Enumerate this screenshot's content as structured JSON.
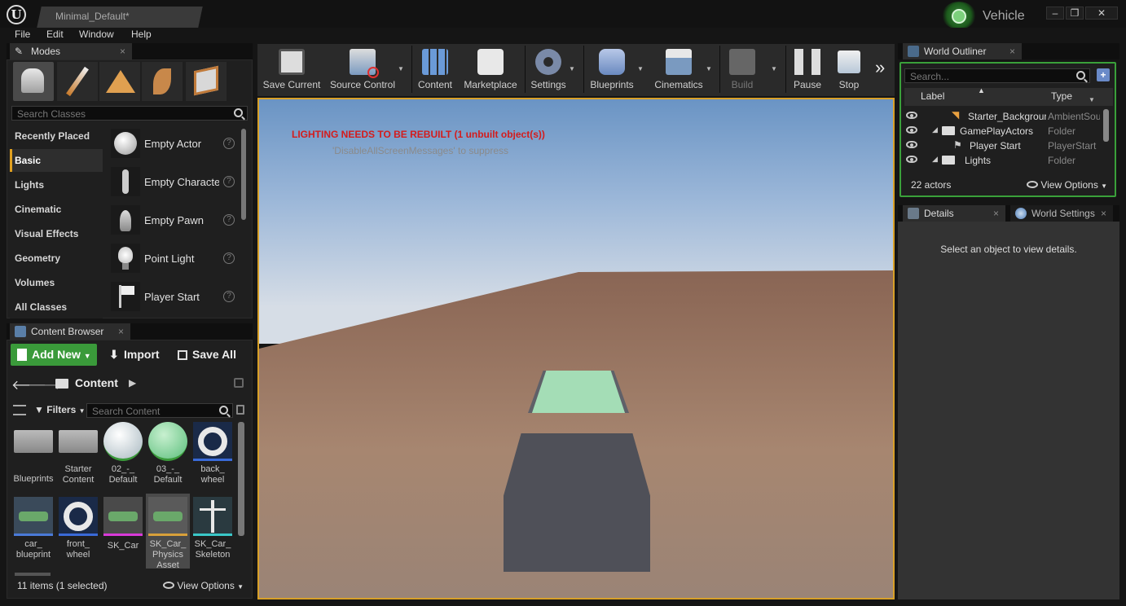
{
  "window": {
    "tab_title": "Minimal_Default*",
    "project_badge": "Vehicle",
    "controls": {
      "minimize": "–",
      "restore": "❐",
      "close": "✕"
    }
  },
  "menu": [
    "File",
    "Edit",
    "Window",
    "Help"
  ],
  "modes": {
    "tab_label": "Modes",
    "search_placeholder": "Search Classes",
    "categories": [
      "Recently Placed",
      "Basic",
      "Lights",
      "Cinematic",
      "Visual Effects",
      "Geometry",
      "Volumes",
      "All Classes"
    ],
    "selected_category": "Basic",
    "items": [
      "Empty Actor",
      "Empty Characte",
      "Empty Pawn",
      "Point Light",
      "Player Start"
    ]
  },
  "toolbar": {
    "buttons": [
      "Save Current",
      "Source Control",
      "Content",
      "Marketplace",
      "Settings",
      "Blueprints",
      "Cinematics",
      "Build",
      "Pause",
      "Stop"
    ],
    "overflow": "»"
  },
  "viewport": {
    "warning": "LIGHTING NEEDS TO BE REBUILT (1 unbuilt object(s))",
    "suppress_hint": "'DisableAllScreenMessages' to suppress",
    "warning_color": "#d41c1c"
  },
  "content_browser": {
    "tab_label": "Content Browser",
    "add_new": "Add New",
    "import": "Import",
    "save_all": "Save All",
    "path": "Content",
    "filters": "Filters",
    "search_placeholder": "Search Content",
    "assets": [
      {
        "label": "Blueprints",
        "icon": "folder-icon"
      },
      {
        "label": "Starter Content",
        "icon": "folder-icon"
      },
      {
        "label": "02_-_ Default",
        "icon": "material-white-icon"
      },
      {
        "label": "03_-_ Default",
        "icon": "material-green-icon"
      },
      {
        "label": "back_ wheel",
        "icon": "wheel-icon"
      },
      {
        "label": "car_ blueprint",
        "icon": "car-blueprint-icon"
      },
      {
        "label": "front_ wheel",
        "icon": "wheel-icon"
      },
      {
        "label": "SK_Car",
        "icon": "skeletal-mesh-icon"
      },
      {
        "label": "SK_Car_ Physics Asset",
        "icon": "physics-asset-icon"
      },
      {
        "label": "SK_Car_ Skeleton",
        "icon": "skeleton-icon"
      }
    ],
    "status": "11 items (1 selected)",
    "view_options": "View Options"
  },
  "world_outliner": {
    "tab_label": "World Outliner",
    "search_placeholder": "Search...",
    "col_label": "Label",
    "col_type": "Type",
    "rows": [
      {
        "label": "Starter_Backgrour",
        "type": "AmbientSou",
        "indent": 3
      },
      {
        "label": "GamePlayActors",
        "type": "Folder",
        "indent": 1
      },
      {
        "label": "Player Start",
        "type": "PlayerStart",
        "indent": 3
      },
      {
        "label": "Lights",
        "type": "Folder",
        "indent": 1
      }
    ],
    "actor_count": "22 actors",
    "view_options": "View Options"
  },
  "details": {
    "tab_label": "Details",
    "world_settings_tab": "World Settings",
    "empty_message": "Select an object to view details."
  }
}
